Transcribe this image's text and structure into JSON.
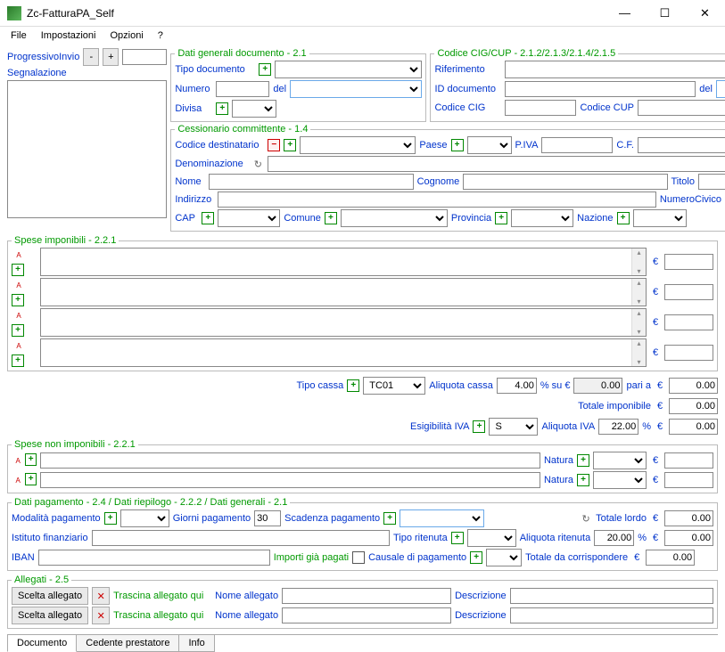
{
  "window": {
    "title": "Zc-FatturaPA_Self"
  },
  "menu": {
    "file": "File",
    "impostazioni": "Impostazioni",
    "opzioni": "Opzioni",
    "help": "?"
  },
  "progressivo": {
    "label": "ProgressivoInvio",
    "minus": "-",
    "plus": "+"
  },
  "segnalazione": {
    "label": "Segnalazione"
  },
  "dati_generali": {
    "legend": "Dati generali documento - 2.1",
    "tipo_documento": "Tipo documento",
    "numero": "Numero",
    "del": "del",
    "divisa": "Divisa"
  },
  "codice_cig": {
    "legend": "Codice CIG/CUP - 2.1.2/2.1.3/2.1.4/2.1.5",
    "riferimento": "Riferimento",
    "id_documento": "ID documento",
    "del": "del",
    "codice_cig": "Codice CIG",
    "codice_cup": "Codice CUP"
  },
  "cessionario": {
    "legend": "Cessionario committente - 1.4",
    "codice_destinatario": "Codice destinatario",
    "paese": "Paese",
    "piva": "P.IVA",
    "cf": "C.F.",
    "denominazione": "Denominazione",
    "nome": "Nome",
    "cognome": "Cognome",
    "titolo": "Titolo",
    "indirizzo": "Indirizzo",
    "numero_civico": "NumeroCivico",
    "cap": "CAP",
    "comune": "Comune",
    "provincia": "Provincia",
    "nazione": "Nazione"
  },
  "spese_imp": {
    "legend": "Spese imponibili - 2.2.1"
  },
  "cassa": {
    "tipo_cassa": "Tipo cassa",
    "tipo_cassa_val": "TC01",
    "aliquota_cassa": "Aliquota cassa",
    "aliquota_cassa_val": "4.00",
    "perc_su": "% su €",
    "perc_su_val": "0.00",
    "pari_a": "pari a",
    "totale_imponibile": "Totale imponibile",
    "esigibilita": "Esigibilità IVA",
    "esig_val": "S",
    "aliquota_iva": "Aliquota IVA",
    "aliquota_iva_val": "22.00",
    "perc": "%",
    "zero": "0.00"
  },
  "spese_non": {
    "legend": "Spese non imponibili - 2.2.1",
    "natura": "Natura"
  },
  "pagamento": {
    "legend": "Dati pagamento - 2.4 / Dati riepilogo - 2.2.2 / Dati generali - 2.1",
    "modalita": "Modalità pagamento",
    "giorni": "Giorni pagamento",
    "giorni_val": "30",
    "scadenza": "Scadenza pagamento",
    "totale_lordo": "Totale lordo",
    "istituto": "Istituto finanziario",
    "tipo_ritenuta": "Tipo ritenuta",
    "aliquota_ritenuta": "Aliquota ritenuta",
    "aliquota_ritenuta_val": "20.00",
    "iban": "IBAN",
    "importi_pagati": "Importi già pagati",
    "causale": "Causale di pagamento",
    "totale_corr": "Totale da corrispondere",
    "zero": "0.00",
    "perc": "%"
  },
  "allegati": {
    "legend": "Allegati - 2.5",
    "scelta": "Scelta allegato",
    "trascina": "Trascina allegato qui",
    "nome": "Nome allegato",
    "descrizione": "Descrizione"
  },
  "tabs": {
    "documento": "Documento",
    "cedente": "Cedente prestatore",
    "info": "Info"
  },
  "euro": "€"
}
